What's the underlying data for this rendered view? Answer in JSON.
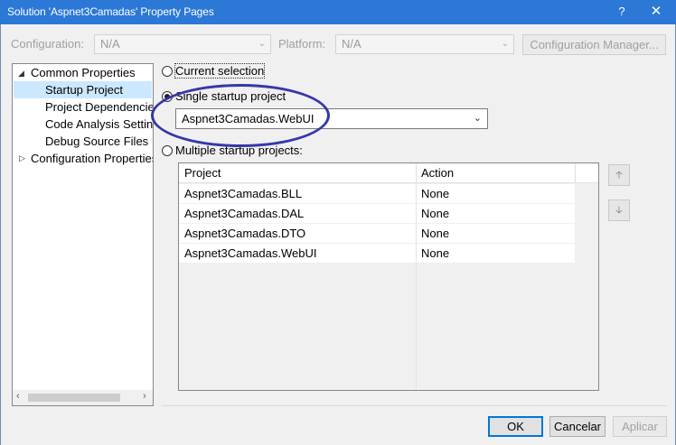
{
  "window": {
    "title": "Solution 'Aspnet3Camadas' Property Pages",
    "help_glyph": "?",
    "close_glyph": "✕"
  },
  "toolbar": {
    "configuration_label": "Configuration:",
    "configuration_value": "N/A",
    "platform_label": "Platform:",
    "platform_value": "N/A",
    "config_manager_label": "Configuration Manager..."
  },
  "tree": {
    "items": [
      {
        "label": "Common Properties",
        "expanded": true
      },
      {
        "label": "Startup Project",
        "selected": true
      },
      {
        "label": "Project Dependencies"
      },
      {
        "label": "Code Analysis Settings"
      },
      {
        "label": "Debug Source Files"
      },
      {
        "label": "Configuration Properties",
        "expanded": false
      }
    ]
  },
  "startup": {
    "option_current": "Current selection",
    "option_single": "Single startup project",
    "option_multiple": "Multiple startup projects:",
    "selected_option": "single",
    "single_project_value": "Aspnet3Camadas.WebUI"
  },
  "grid": {
    "headers": [
      "Project",
      "Action"
    ],
    "rows": [
      {
        "project": "Aspnet3Camadas.BLL",
        "action": "None"
      },
      {
        "project": "Aspnet3Camadas.DAL",
        "action": "None"
      },
      {
        "project": "Aspnet3Camadas.DTO",
        "action": "None"
      },
      {
        "project": "Aspnet3Camadas.WebUI",
        "action": "None"
      }
    ]
  },
  "buttons": {
    "ok": "OK",
    "cancel": "Cancelar",
    "apply": "Aplicar"
  },
  "colors": {
    "titlebar": "#2b78d6",
    "annotation_ellipse": "#3538a8",
    "selection": "#cce8ff"
  }
}
